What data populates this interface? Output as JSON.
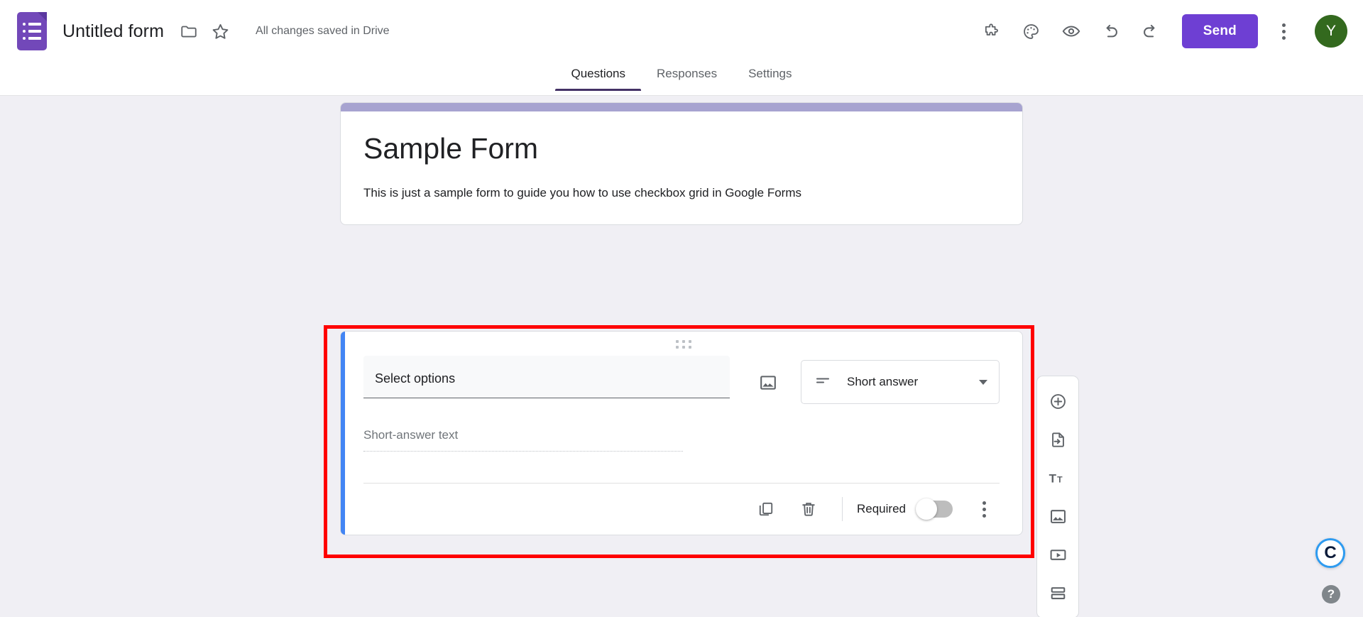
{
  "topbar": {
    "logo_icon": "google-forms-logo-icon",
    "form_title": "Untitled form",
    "move_to_folder_icon": "folder-icon",
    "star_icon": "star-icon",
    "save_status": "All changes saved in Drive",
    "addons_icon": "puzzle-piece-icon",
    "theme_icon": "palette-icon",
    "preview_icon": "eye-icon",
    "undo_icon": "undo-icon",
    "redo_icon": "redo-icon",
    "send_label": "Send",
    "more_icon": "kebab-menu-icon",
    "avatar_initial": "Y",
    "avatar_color": "#33691e",
    "send_color": "#6e3fd3"
  },
  "tabs": [
    {
      "label": "Questions",
      "active": true
    },
    {
      "label": "Responses",
      "active": false
    },
    {
      "label": "Settings",
      "active": false
    }
  ],
  "form_header": {
    "accent_color": "#a7a3d0",
    "title": "Sample Form",
    "description": "This is just a sample form to guide you how to use checkbox grid in Google Forms"
  },
  "question_card": {
    "accent_color": "#4285f4",
    "drag_handle_icon": "drag-handle-icon",
    "question_title": "Select options",
    "add_image_icon": "image-icon",
    "question_type": {
      "icon": "short-answer-icon",
      "label": "Short answer",
      "caret_icon": "chevron-down-icon"
    },
    "answer_placeholder": "Short-answer text",
    "actions": {
      "duplicate_icon": "duplicate-icon",
      "delete_icon": "trash-icon",
      "required_label": "Required",
      "required_on": false,
      "more_icon": "kebab-menu-icon"
    }
  },
  "highlight": {
    "color": "#ff0000"
  },
  "side_toolbar": [
    {
      "icon": "add-question-icon"
    },
    {
      "icon": "import-questions-icon"
    },
    {
      "icon": "add-title-description-icon"
    },
    {
      "icon": "add-image-icon"
    },
    {
      "icon": "add-video-icon"
    },
    {
      "icon": "add-section-icon"
    }
  ],
  "floating": {
    "grammarly_label": "C",
    "help_label": "?"
  }
}
